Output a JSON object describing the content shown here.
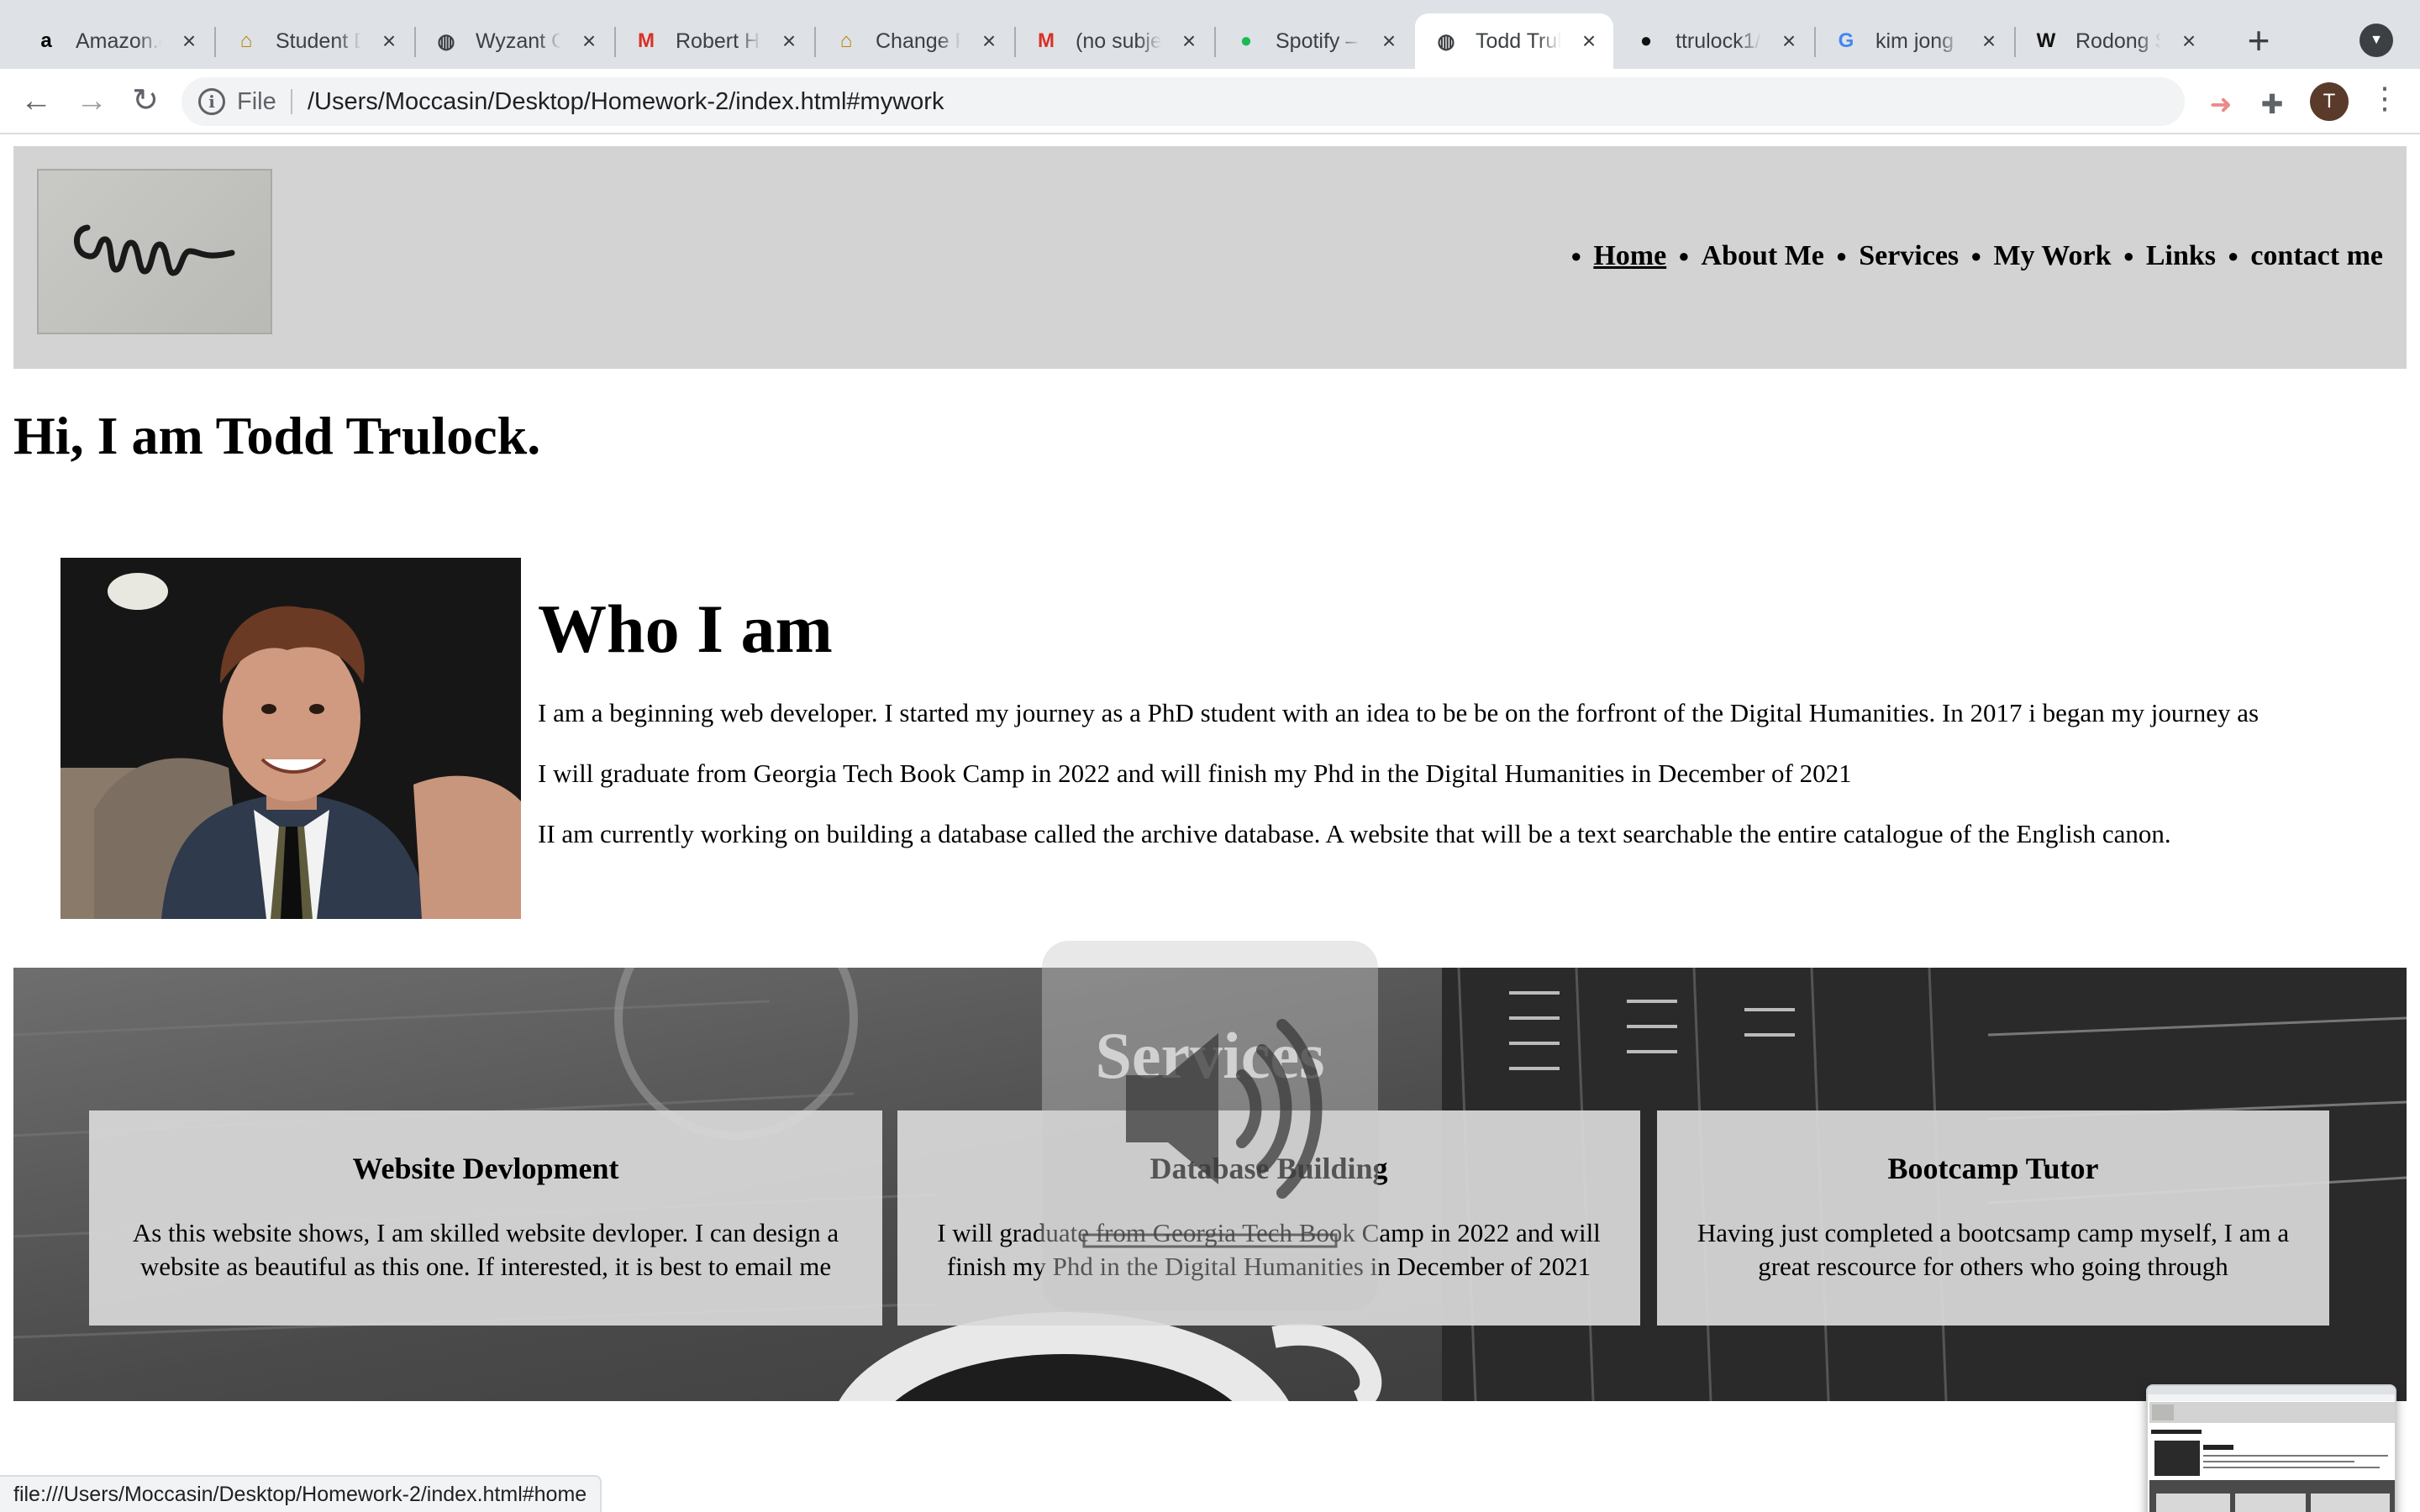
{
  "browser": {
    "tabs": [
      {
        "title": "Amazon.c",
        "icon": "amazon-icon",
        "active": false
      },
      {
        "title": "Student D",
        "icon": "home-icon",
        "active": false
      },
      {
        "title": "Wyzant O",
        "icon": "globe-icon",
        "active": false
      },
      {
        "title": "Robert H.",
        "icon": "gmail-icon",
        "active": false
      },
      {
        "title": "Change P",
        "icon": "home-icon",
        "active": false
      },
      {
        "title": "(no subje",
        "icon": "gmail-icon",
        "active": false
      },
      {
        "title": "Spotify –",
        "icon": "spotify-icon",
        "active": false
      },
      {
        "title": "Todd Trul",
        "icon": "globe-icon",
        "active": true
      },
      {
        "title": "ttrulock1/",
        "icon": "github-icon",
        "active": false
      },
      {
        "title": "kim jong",
        "icon": "google-icon",
        "active": false
      },
      {
        "title": "Rodong S",
        "icon": "wikipedia-icon",
        "active": false
      }
    ],
    "address": {
      "scheme_label": "File",
      "url": "/Users/Moccasin/Desktop/Homework-2/index.html#mywork"
    },
    "profile_initial": "T",
    "status_url": "file:///Users/Moccasin/Desktop/Homework-2/index.html#home"
  },
  "site": {
    "nav": [
      "Home",
      "About Me",
      "Services",
      "My Work",
      "Links",
      "contact me"
    ],
    "greeting": "Hi, I am Todd Trulock.",
    "about": {
      "heading": "Who I am",
      "paragraphs": [
        "I am a beginning web developer. I started my journey as a PhD student with an idea to be be on the forfront of the Digital Humanities. In 2017 i began my journey as",
        "I will graduate from Georgia Tech Book Camp in 2022 and will finish my Phd in the Digital Humanities in December of 2021",
        "II am currently working on building a database called the archive database. A website that will be a text searchable the entire catalogue of the English canon."
      ]
    },
    "services": {
      "heading": "Services",
      "cards": [
        {
          "title": "Website Devlopment",
          "text": "As this website shows, I am skilled website devloper. I can design a website as beautiful as this one. If interested, it is best to email me"
        },
        {
          "title": "Database Building",
          "text": "I will graduate from Georgia Tech Book Camp in 2022 and will finish my Phd in the Digital Humanities in December of 2021"
        },
        {
          "title": "Bootcamp Tutor",
          "text": "Having just completed a bootcsamp camp myself, I am a great rescource for others who going through"
        }
      ]
    }
  },
  "colors": {
    "tabstrip": "#dee1e6",
    "header_bg": "#d3d3d3",
    "services_band": "#4a4a4a",
    "card_bg": "#d8d8d8"
  }
}
